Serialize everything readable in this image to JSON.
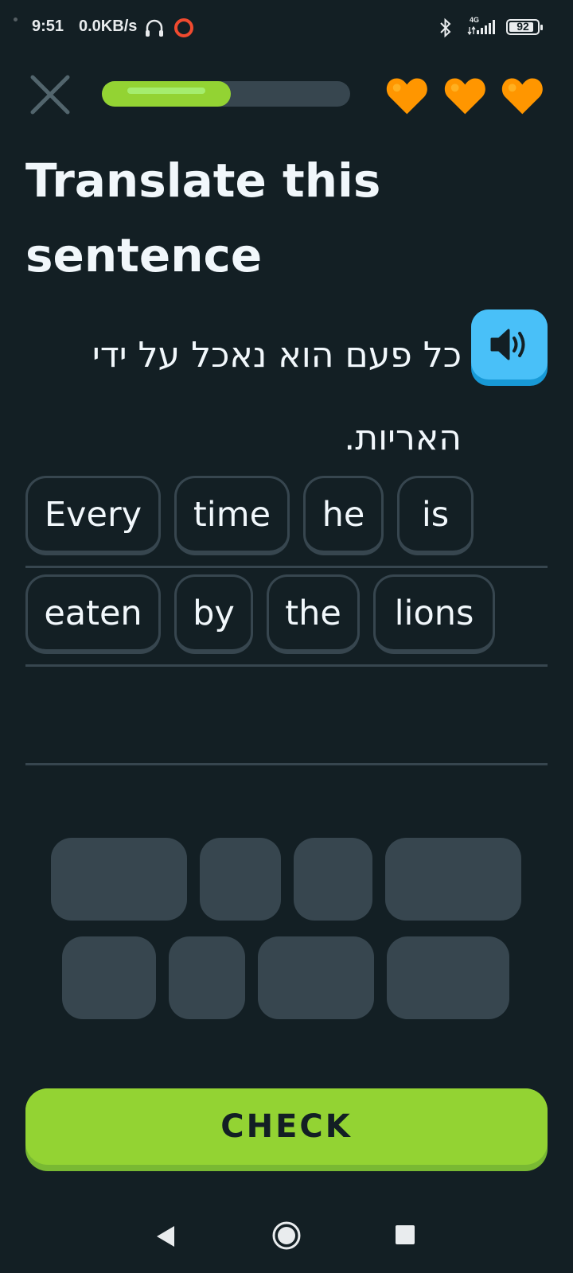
{
  "status_bar": {
    "time": "9:51",
    "net_speed": "0.0KB/s",
    "network": "4G",
    "battery": "92"
  },
  "header": {
    "progress_fraction": 0.52,
    "hearts_count": 3,
    "icons": [
      "close-icon",
      "heart-icon"
    ]
  },
  "title": "Translate this sentence",
  "prompt": {
    "sentence": "כל פעם הוא נאכל על ידי האריות.",
    "speaker_icon": "speaker-icon"
  },
  "answer_tiles": [
    "Every",
    "time",
    "he",
    "is",
    "eaten",
    "by",
    "the",
    "lions"
  ],
  "check_label": "CHECK",
  "colors": {
    "background": "#131F24",
    "accent_green": "#93D333",
    "speaker_blue": "#49C0F8",
    "heart_orange": "#FF9600",
    "tile_border": "#37464F"
  }
}
